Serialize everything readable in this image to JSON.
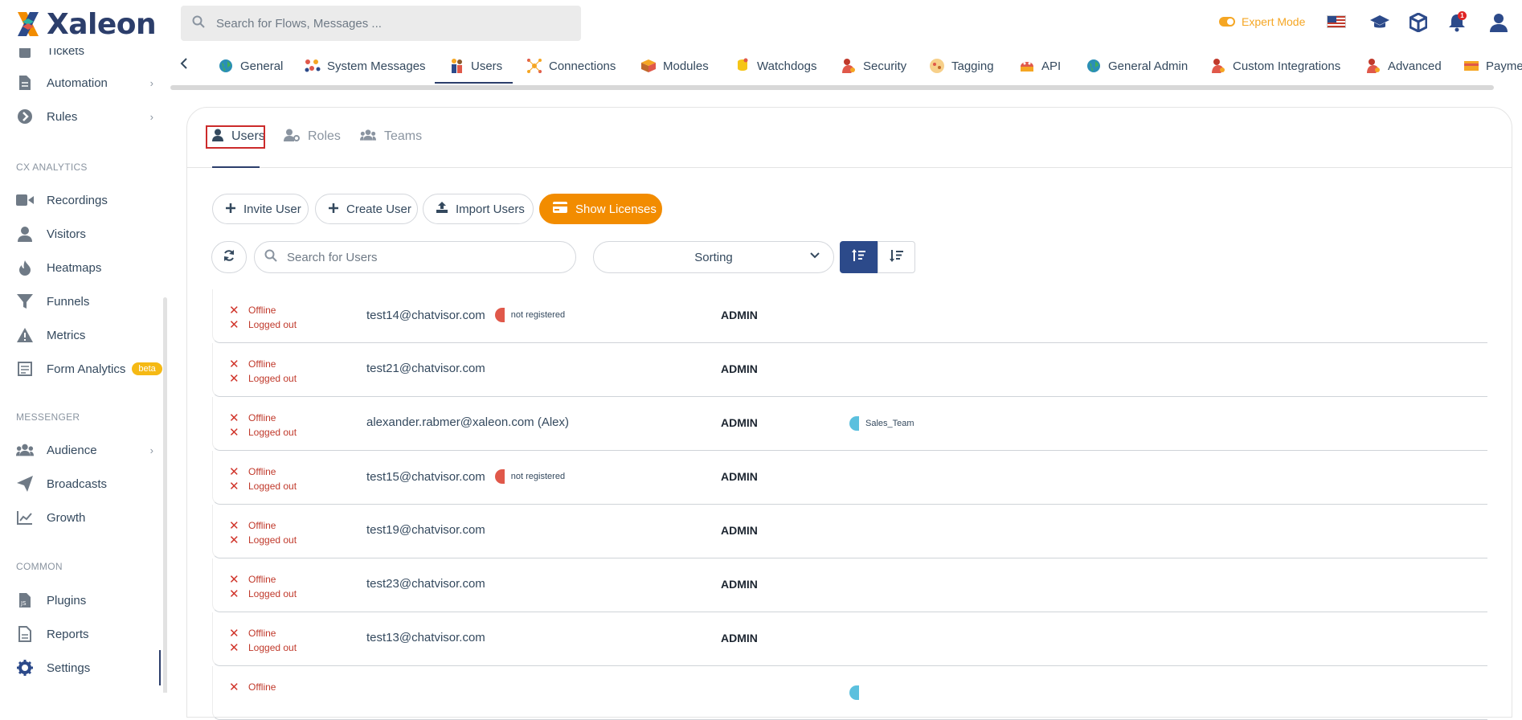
{
  "brand": {
    "name": "Xaleon",
    "accent": "#f28c00",
    "primary": "#2c4a8a",
    "danger": "#d0352b"
  },
  "header": {
    "search_placeholder": "Search for Flows, Messages ...",
    "expert_mode_label": "Expert Mode",
    "notification_count": "1",
    "icons": [
      "flag-us-icon",
      "graduation-cap-icon",
      "cube-icon",
      "bell-icon",
      "user-icon"
    ]
  },
  "sidebar": {
    "items_top": [
      {
        "label": "Tickets",
        "icon": "ticket-icon",
        "chevron": false
      },
      {
        "label": "Automation",
        "icon": "document-icon",
        "chevron": true
      },
      {
        "label": "Rules",
        "icon": "arrow-circle-icon",
        "chevron": true
      }
    ],
    "section_cx": "CX ANALYTICS",
    "items_cx": [
      {
        "label": "Recordings",
        "icon": "video-icon"
      },
      {
        "label": "Visitors",
        "icon": "user-icon"
      },
      {
        "label": "Heatmaps",
        "icon": "fire-icon"
      },
      {
        "label": "Funnels",
        "icon": "filter-icon"
      },
      {
        "label": "Metrics",
        "icon": "warning-icon"
      },
      {
        "label": "Form Analytics",
        "icon": "form-icon",
        "badge": "beta"
      }
    ],
    "section_messenger": "MESSENGER",
    "items_messenger": [
      {
        "label": "Audience",
        "icon": "users-icon",
        "chevron": true
      },
      {
        "label": "Broadcasts",
        "icon": "paper-plane-icon"
      },
      {
        "label": "Growth",
        "icon": "chart-line-icon"
      }
    ],
    "section_common": "COMMON",
    "items_common": [
      {
        "label": "Plugins",
        "icon": "js-file-icon"
      },
      {
        "label": "Reports",
        "icon": "report-icon"
      },
      {
        "label": "Settings",
        "icon": "gear-icon",
        "active": true
      }
    ]
  },
  "settings_tabs": [
    {
      "label": "General",
      "icon": "globe-icon"
    },
    {
      "label": "System Messages",
      "icon": "messages-icon"
    },
    {
      "label": "Users",
      "icon": "users-tab-icon",
      "active": true
    },
    {
      "label": "Connections",
      "icon": "connections-icon"
    },
    {
      "label": "Modules",
      "icon": "modules-icon"
    },
    {
      "label": "Watchdogs",
      "icon": "watchdog-icon"
    },
    {
      "label": "Security",
      "icon": "security-icon"
    },
    {
      "label": "Tagging",
      "icon": "tag-icon"
    },
    {
      "label": "API",
      "icon": "api-icon"
    },
    {
      "label": "General Admin",
      "icon": "globe-icon"
    },
    {
      "label": "Custom Integrations",
      "icon": "integrations-icon"
    },
    {
      "label": "Advanced",
      "icon": "advanced-icon"
    },
    {
      "label": "Payme",
      "icon": "payment-icon"
    }
  ],
  "subtabs": [
    {
      "label": "Users",
      "icon": "user-icon",
      "active": true
    },
    {
      "label": "Roles",
      "icon": "user-gear-icon"
    },
    {
      "label": "Teams",
      "icon": "users-icon"
    }
  ],
  "actions": {
    "invite_user": "Invite User",
    "create_user": "Create User",
    "import_users": "Import Users",
    "show_licenses": "Show Licenses"
  },
  "filters": {
    "search_placeholder": "Search for Users",
    "sorting_label": "Sorting"
  },
  "users": [
    {
      "status": "Offline",
      "login": "Logged out",
      "email": "test14@chatvisor.com",
      "tag": "not registered",
      "tag_color": "#e0584a",
      "role": "ADMIN",
      "team": "",
      "team_color": ""
    },
    {
      "status": "Offline",
      "login": "Logged out",
      "email": "test21@chatvisor.com",
      "tag": "",
      "tag_color": "",
      "role": "ADMIN",
      "team": "",
      "team_color": ""
    },
    {
      "status": "Offline",
      "login": "Logged out",
      "email": "alexander.rabmer@xaleon.com (Alex)",
      "tag": "",
      "tag_color": "",
      "role": "ADMIN",
      "team": "Sales_Team",
      "team_color": "#5bc0de"
    },
    {
      "status": "Offline",
      "login": "Logged out",
      "email": "test15@chatvisor.com",
      "tag": "not registered",
      "tag_color": "#e0584a",
      "role": "ADMIN",
      "team": "",
      "team_color": ""
    },
    {
      "status": "Offline",
      "login": "Logged out",
      "email": "test19@chatvisor.com",
      "tag": "",
      "tag_color": "",
      "role": "ADMIN",
      "team": "",
      "team_color": ""
    },
    {
      "status": "Offline",
      "login": "Logged out",
      "email": "test23@chatvisor.com",
      "tag": "",
      "tag_color": "",
      "role": "ADMIN",
      "team": "",
      "team_color": ""
    },
    {
      "status": "Offline",
      "login": "Logged out",
      "email": "test13@chatvisor.com",
      "tag": "",
      "tag_color": "",
      "role": "ADMIN",
      "team": "",
      "team_color": ""
    },
    {
      "status": "Offline",
      "login": "",
      "email": "",
      "tag": "",
      "tag_color": "",
      "role": "",
      "team": "",
      "team_color": "#5bc0de"
    }
  ]
}
